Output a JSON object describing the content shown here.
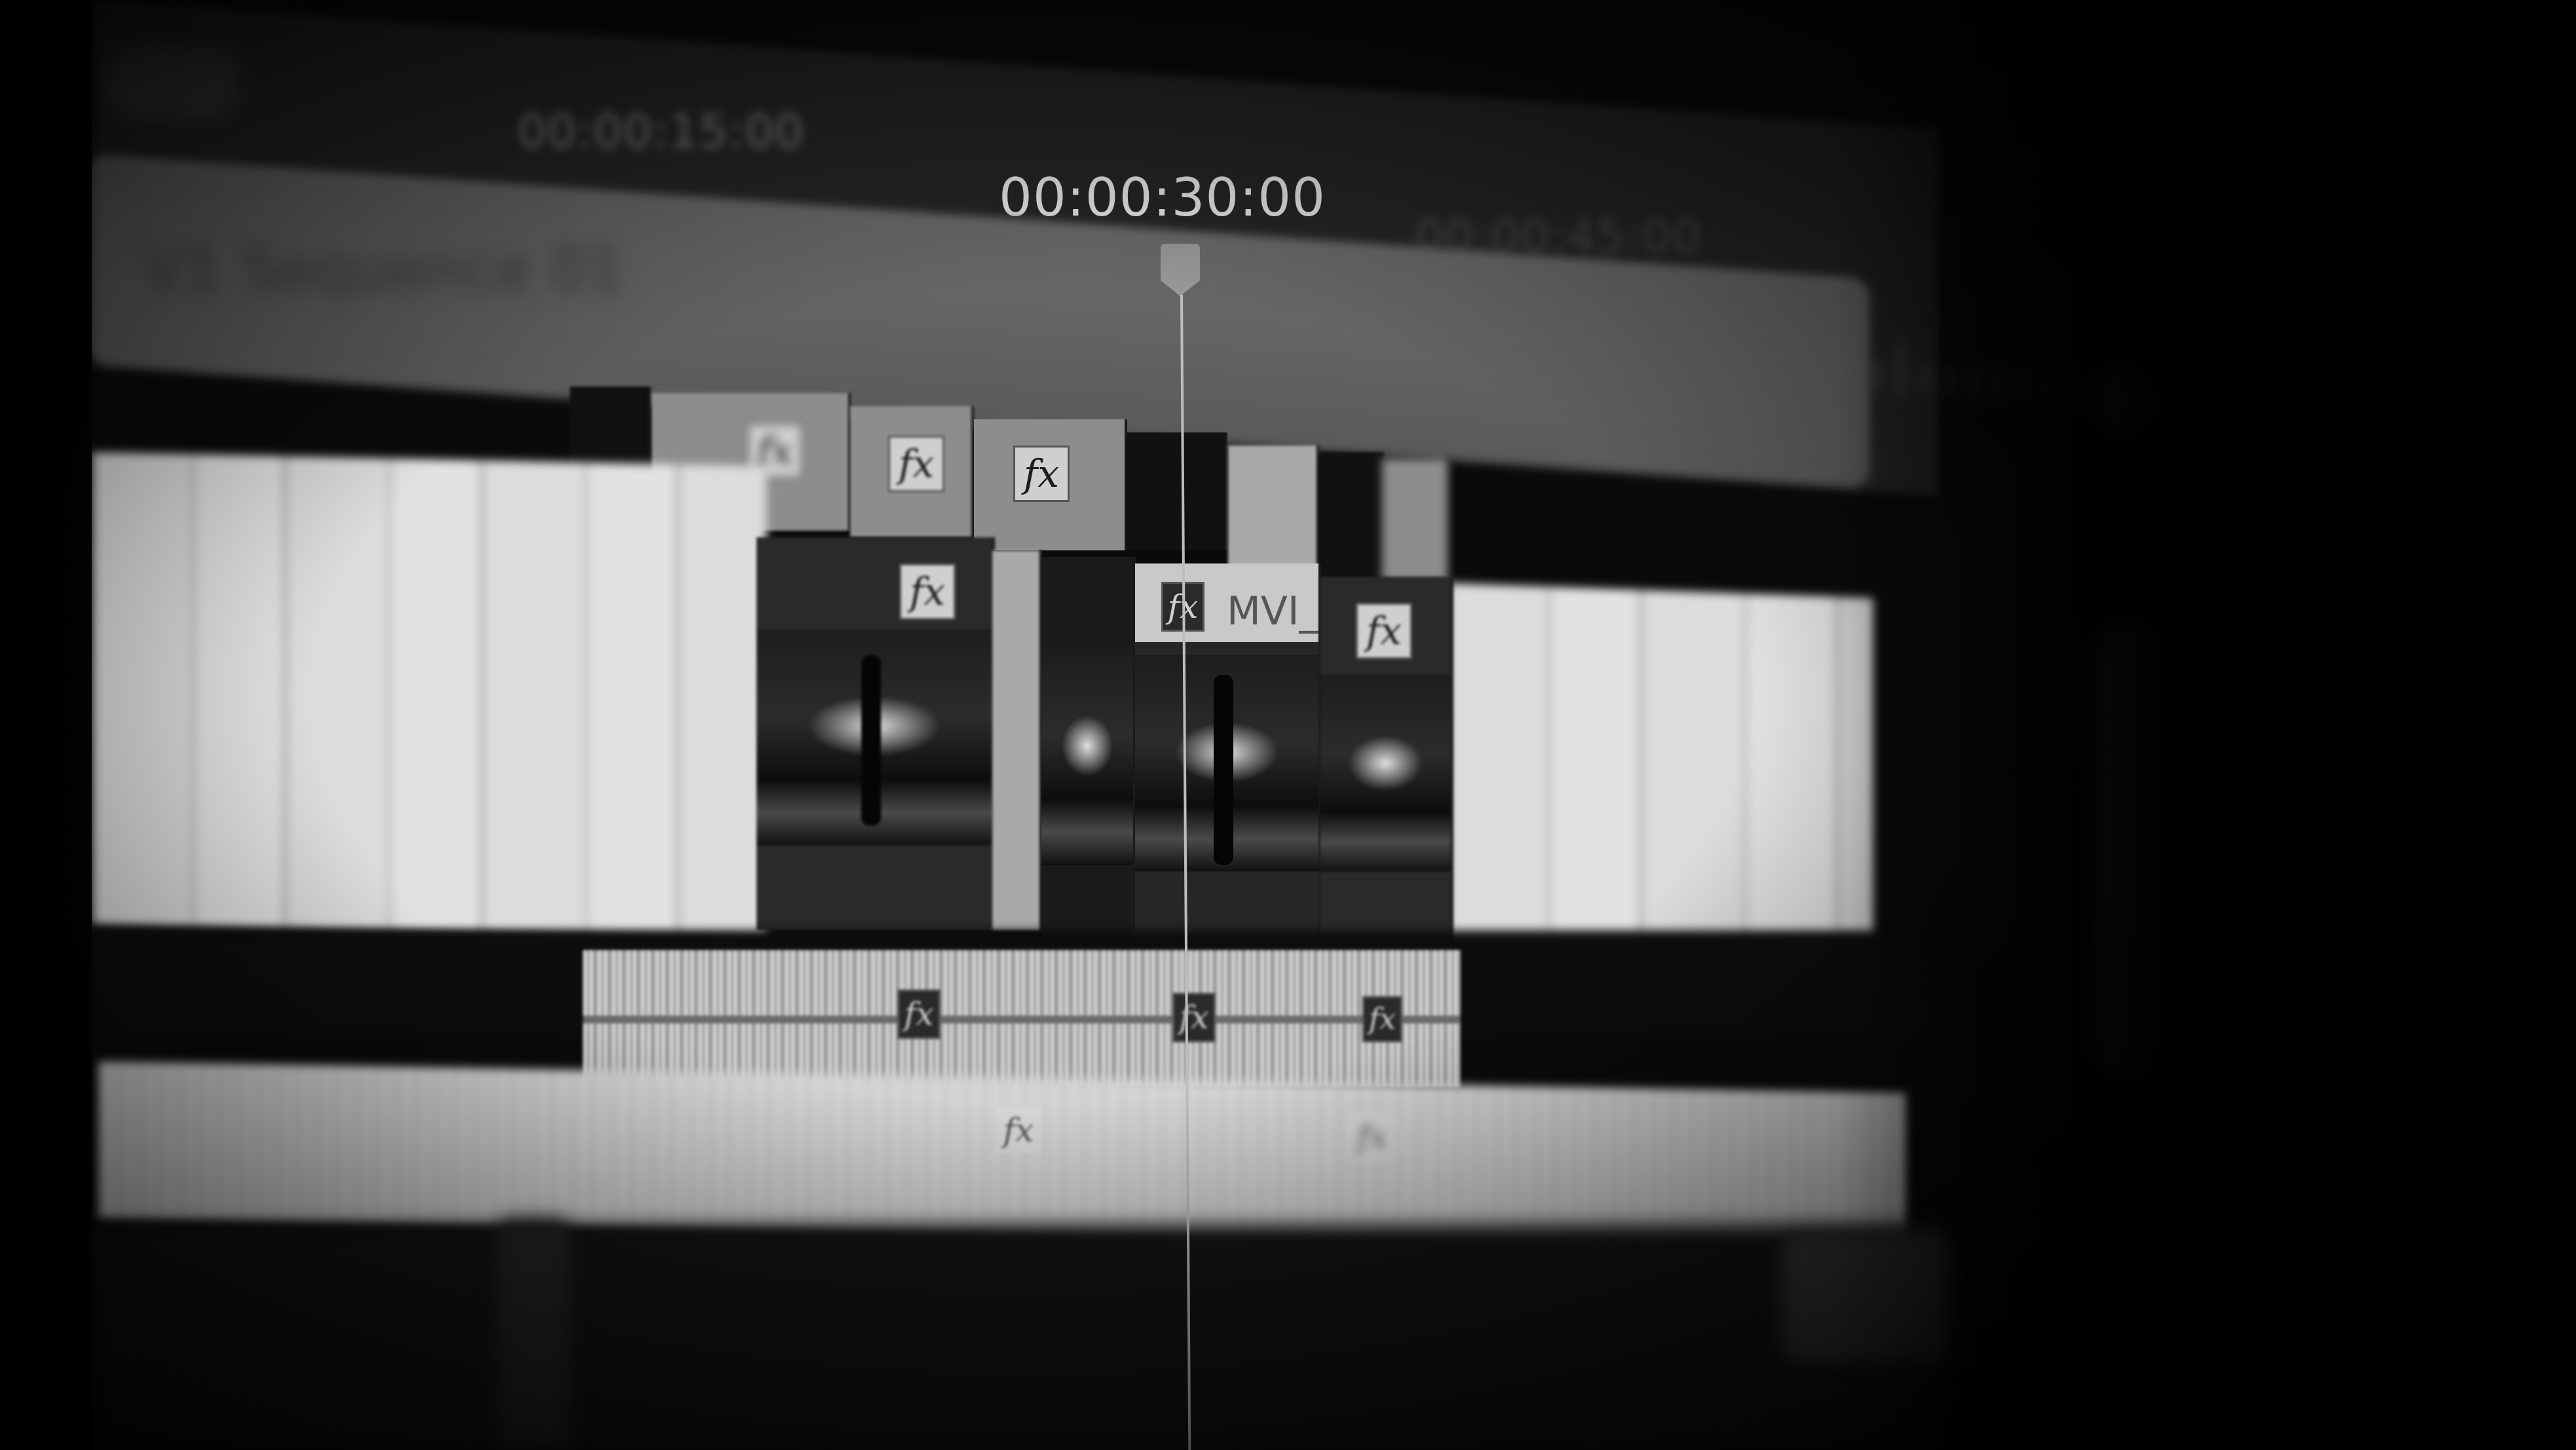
{
  "timeline": {
    "timecode_main": "00:00:30:00",
    "timecode_left": "00:00:15:00",
    "timecode_right": "00:00:45:00",
    "sequence_label": "V1 Sequence 01"
  },
  "clips": {
    "fx": "fx",
    "clip_name": "MVI_"
  },
  "colors": {
    "background": "#0a0a0a",
    "panel": "#262626",
    "work_area": "#5f5f5f",
    "video_track": "#dcdcdc",
    "playhead": "#bdbdbd"
  },
  "icons": [
    "fx-badge-icon",
    "playhead-icon"
  ]
}
